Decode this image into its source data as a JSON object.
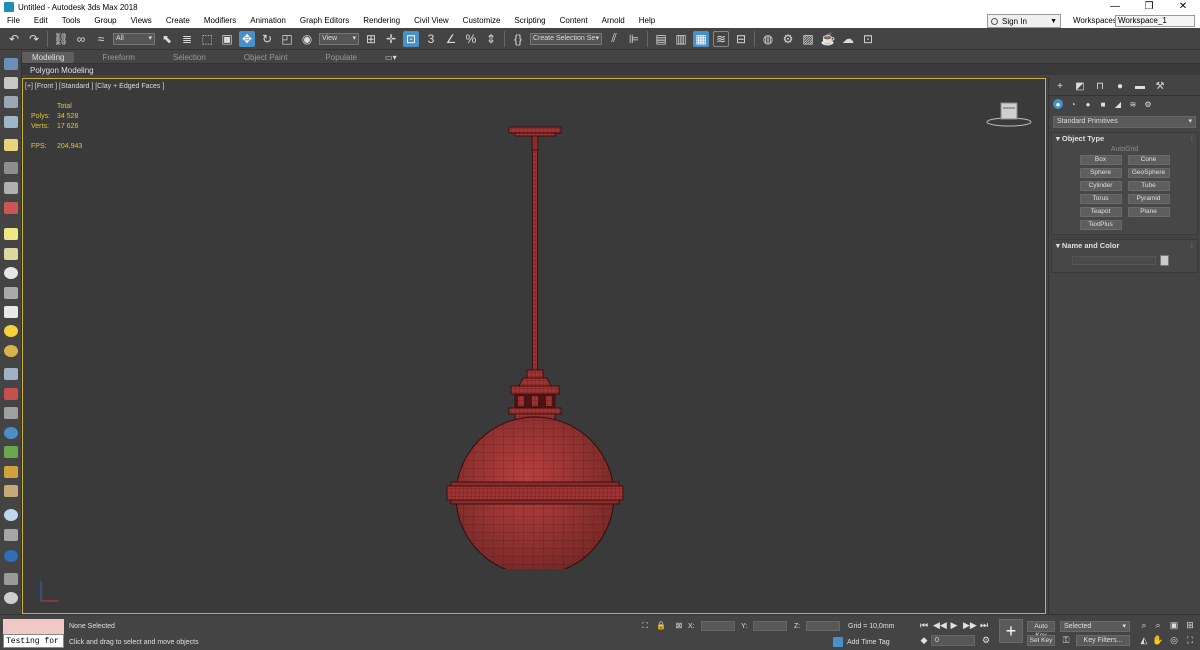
{
  "titlebar": {
    "title": "Untitled - Autodesk 3ds Max 2018",
    "min": "—",
    "max": "❐",
    "close": "✕"
  },
  "menubar": {
    "items": [
      "File",
      "Edit",
      "Tools",
      "Group",
      "Views",
      "Create",
      "Modifiers",
      "Animation",
      "Graph Editors",
      "Rendering",
      "Civil View",
      "Customize",
      "Scripting",
      "Content",
      "Arnold",
      "Help"
    ],
    "signin": "Sign In",
    "workspaces_label": "Workspaces:",
    "workspace": "Workspace_1"
  },
  "toolbar": {
    "filter": "All",
    "view_ref": "View",
    "snap_angle": "3",
    "selection_set": "Create Selection Se"
  },
  "ribbon": {
    "tabs": [
      "Modeling",
      "Freeform",
      "Selection",
      "Object Paint",
      "Populate"
    ],
    "active_tab": "Modeling",
    "sub_label": "Polygon Modeling"
  },
  "viewport": {
    "label": "[+] [Front ] [Standard ] [Clay + Edged Faces ]",
    "stats": {
      "header": "Total",
      "polys_label": "Polys:",
      "polys": "34 528",
      "verts_label": "Verts:",
      "verts": "17 626",
      "fps_label": "FPS:",
      "fps": "204,943"
    },
    "border_color": "#c9b13a",
    "model_color": "#b8403e"
  },
  "command_panel": {
    "category": "Standard Primitives",
    "object_type_title": "Object Type",
    "autogrid": "AutoGrid",
    "objects": [
      "Box",
      "Cone",
      "Sphere",
      "GeoSphere",
      "Cylinder",
      "Tube",
      "Torus",
      "Pyramid",
      "Teapot",
      "Plane",
      "TextPlus"
    ],
    "name_color_title": "Name and Color"
  },
  "status": {
    "maxscript_text": "Testing for :",
    "selection": "None Selected",
    "prompt": "Click and drag to select and move objects",
    "x_label": "X:",
    "y_label": "Y:",
    "z_label": "Z:",
    "grid": "Grid = 10,0mm",
    "add_time_tag": "Add Time Tag",
    "frame": "0",
    "auto_key": "Auto Key",
    "set_key": "Set Key",
    "selected": "Selected",
    "key_filters": "Key Filters..."
  }
}
